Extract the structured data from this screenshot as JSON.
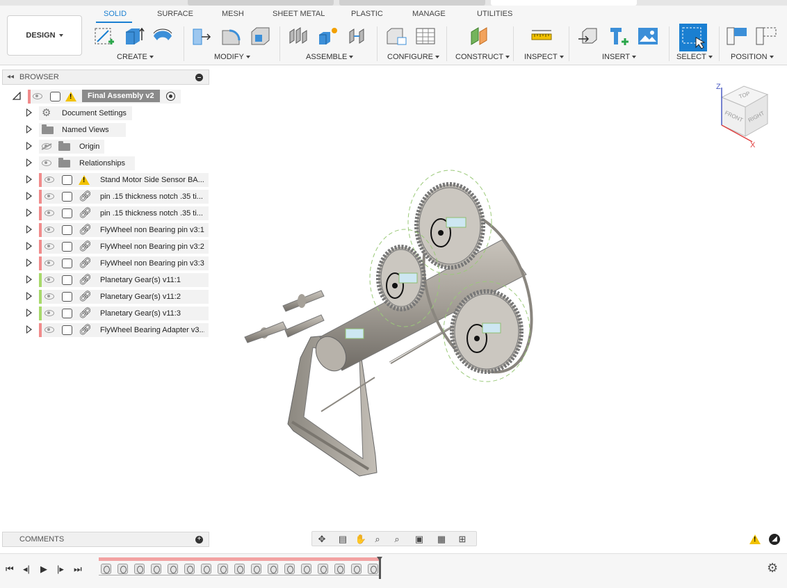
{
  "ribbon": {
    "workspace_button": "DESIGN",
    "tabs": [
      {
        "label": "SOLID",
        "active": true
      },
      {
        "label": "SURFACE",
        "active": false
      },
      {
        "label": "MESH",
        "active": false
      },
      {
        "label": "SHEET METAL",
        "active": false
      },
      {
        "label": "PLASTIC",
        "active": false
      },
      {
        "label": "MANAGE",
        "active": false
      },
      {
        "label": "UTILITIES",
        "active": false
      }
    ],
    "groups": {
      "create": "CREATE",
      "modify": "MODIFY",
      "assemble": "ASSEMBLE",
      "configure": "CONFIGURE",
      "construct": "CONSTRUCT",
      "inspect": "INSPECT",
      "insert": "INSERT",
      "select": "SELECT",
      "position": "POSITION"
    }
  },
  "browser": {
    "title": "BROWSER",
    "root": "Final Assembly v2",
    "items": [
      {
        "label": "Document Settings",
        "kind": "settings"
      },
      {
        "label": "Named Views",
        "kind": "folder"
      },
      {
        "label": "Origin",
        "kind": "folder-hidden"
      },
      {
        "label": "Relationships",
        "kind": "folder"
      },
      {
        "label": "Stand Motor Side Sensor BA...",
        "kind": "component-warning",
        "status": "red"
      },
      {
        "label": "pin .15 thickness notch .35 ti...",
        "kind": "component-linked",
        "status": "red"
      },
      {
        "label": "pin .15 thickness notch .35 ti...",
        "kind": "component-linked",
        "status": "red"
      },
      {
        "label": "FlyWheel non Bearing pin v3:1",
        "kind": "component-linked",
        "status": "red"
      },
      {
        "label": "FlyWheel non Bearing pin v3:2",
        "kind": "component-linked",
        "status": "red"
      },
      {
        "label": "FlyWheel non Bearing pin v3:3",
        "kind": "component-linked",
        "status": "red"
      },
      {
        "label": "Planetary Gear(s) v11:1",
        "kind": "component-linked",
        "status": "green"
      },
      {
        "label": "Planetary Gear(s) v11:2",
        "kind": "component-linked",
        "status": "green"
      },
      {
        "label": "Planetary Gear(s) v11:3",
        "kind": "component-linked",
        "status": "green"
      },
      {
        "label": "FlyWheel Bearing Adapter v3...",
        "kind": "component-linked",
        "status": "red"
      }
    ]
  },
  "viewcube": {
    "top": "TOP",
    "front": "FRONT",
    "right": "RIGHT",
    "axis_z": "Z",
    "axis_x": "X"
  },
  "comments": {
    "title": "COMMENTS"
  },
  "colors": {
    "accent": "#1a7fd1",
    "status_red": "#f08c8c",
    "status_green": "#a8d96b",
    "warning": "#f2c200"
  }
}
